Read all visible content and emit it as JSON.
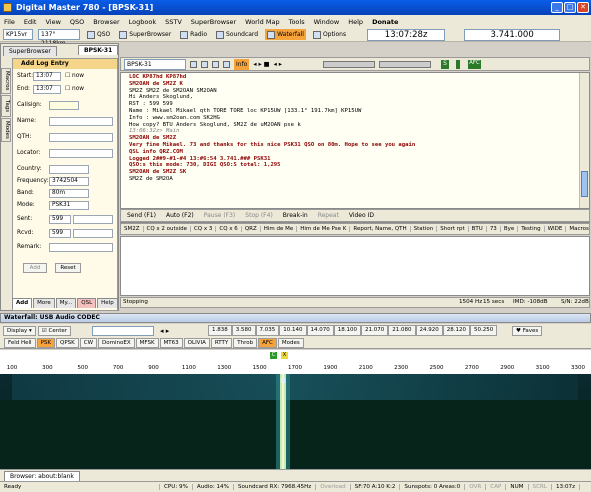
{
  "window": {
    "title": "Digital Master 780 - [BPSK-31]"
  },
  "menu": [
    "File",
    "Edit",
    "View",
    "QSO",
    "Browser",
    "Logbook",
    "SSTV",
    "SuperBrowser",
    "World Map",
    "Tools",
    "Window",
    "Help",
    "Donate"
  ],
  "toolbar": {
    "callsign": "KP15vr",
    "bearing": "137° 2118km",
    "qso": "QSO",
    "superbrowser": "SuperBrowser",
    "radio": "Radio",
    "soundcard": "Soundcard",
    "waterfall": "Waterfall",
    "options": "Options",
    "time": "13:07:28z",
    "frequency": "3.741.000"
  },
  "left": {
    "tabs": [
      "SuperBrowser",
      "BPSK-31"
    ],
    "vtabs": [
      "Macros",
      "Tags",
      "Modes"
    ],
    "log": {
      "title": "Add Log Entry",
      "start": "13:07",
      "end": "13:07",
      "now": "now",
      "labels": {
        "start": "Start:",
        "end": "End:",
        "callsign": "Callsign:",
        "name": "Name:",
        "qth": "QTH:",
        "locator": "Locator:",
        "country": "Country:",
        "frequency": "Frequency:",
        "band": "Band:",
        "mode": "Mode:",
        "sent": "Sent:",
        "rcvd": "Rcvd:",
        "remark": "Remark:"
      },
      "frequency": "3742504",
      "band": "80m",
      "mode": "PSK31",
      "sent": "599",
      "rcvd": "599",
      "add": "Add",
      "reset": "Reset",
      "bottom_tabs": [
        "Add",
        "More",
        "My...",
        "QSL",
        "Help"
      ]
    }
  },
  "rx": {
    "mode_select": "BPSK-31",
    "info": "Info",
    "afc": "AFC",
    "lines": [
      {
        "t": "LOC KP87hd KP87hd",
        "c": "rxbold"
      },
      {
        "t": "SM2OAN de SM2Z K",
        "c": "rxbold"
      },
      {
        "t": "SM2Z SM2Z de SM2OAN SM2OAN",
        "c": "rxtx"
      },
      {
        "t": "Hi Anders Skoglund,",
        "c": "rxtx"
      },
      {
        "t": "RST : 599 599",
        "c": "rxtx"
      },
      {
        "t": "Name : Mikael Mikael qth TORE TORE loc KP15UW [133.1° 191.7km] KP15UW",
        "c": "rxtx"
      },
      {
        "t": "Info : www.sm2oan.com SK2HG",
        "c": "rxtx"
      },
      {
        "t": "How copy? BTU Anders Skoglund, SM2Z de uM2OAN pse k",
        "c": "rxtx"
      },
      {
        "t": "13:06:32z> Main",
        "c": "rxmeta"
      },
      {
        "t": "SM2OAN de SM2Z",
        "c": "rxbold"
      },
      {
        "t": "Very fine Mikael. 73 and thanks for this nice PSK31 QSO on 80m. Hope to see you again",
        "c": "rxbold"
      },
      {
        "t": "QSL info QRZ.COM",
        "c": "rxbold"
      },
      {
        "t": "Logged 2##9-#1-#4 13:#6:54 3.741.### PSK31",
        "c": "rxbold"
      },
      {
        "t": "QSO:s this mode: 730, DIGI QSO:S total: 1,295",
        "c": "rxbold"
      },
      {
        "t": "SM2OAN de SM2Z SK",
        "c": "rxbold"
      },
      {
        "t": "SM2Z de SM2OA",
        "c": "rxtx"
      }
    ],
    "tx_buttons": [
      "Send (F1)",
      "Auto (F2)",
      "Pause (F3)",
      "Stop (F4)",
      "Break-in",
      "Repeat",
      "Video ID"
    ],
    "macros": [
      "SM2Z",
      "CQ x 2 outside",
      "CQ x 3",
      "CQ x 6",
      "QRZ",
      "Him de Me",
      "Him de Me Pse K",
      "Report, Name, QTH",
      "Station",
      "Short rpt",
      "BTU",
      "73",
      "Bye",
      "Testing",
      "WIDE",
      "Macros"
    ],
    "status": {
      "left": "Stopping",
      "freq": "1504 Hz",
      "secs": "15 secs",
      "imd": "IMD: -108dB",
      "sn": "S/N: 22dB"
    }
  },
  "waterfall": {
    "title": "Waterfall: USB Audio CODEC",
    "display": "Display",
    "center": "Center",
    "presets": [
      "1.838",
      "3.580",
      "7.035",
      "10.140",
      "14.070",
      "18.100",
      "21.070",
      "21.080",
      "24.920",
      "28.120",
      "50.250"
    ],
    "faves": "Faves",
    "modes": [
      "Feld Hell",
      "PSK",
      "QPSK",
      "CW",
      "DominoEX",
      "MFSK",
      "MT63",
      "OLIVIA",
      "RTTY",
      "Throb",
      "AFC",
      "Modes"
    ],
    "ticks": [
      "100",
      "300",
      "500",
      "700",
      "900",
      "1100",
      "1300",
      "1500",
      "1700",
      "1900",
      "2100",
      "2300",
      "2500",
      "2700",
      "2900",
      "3100",
      "3300"
    ],
    "marker_c": "C",
    "marker_x": "X"
  },
  "browser_tab": "Browser: about:blank",
  "status": {
    "ready": "Ready",
    "cpu": "CPU: 9%",
    "audio": "Audio: 14%",
    "soundcard": "Soundcard RX: 7968.45Hz",
    "overload": "Overload",
    "sf": "SF:70 A:10 K:2",
    "sunspots": "Sunspots: 0 Areas:0",
    "ovr": "OVR",
    "cap": "CAP",
    "num": "NUM",
    "scrl": "SCRL",
    "time": "13:07z"
  }
}
